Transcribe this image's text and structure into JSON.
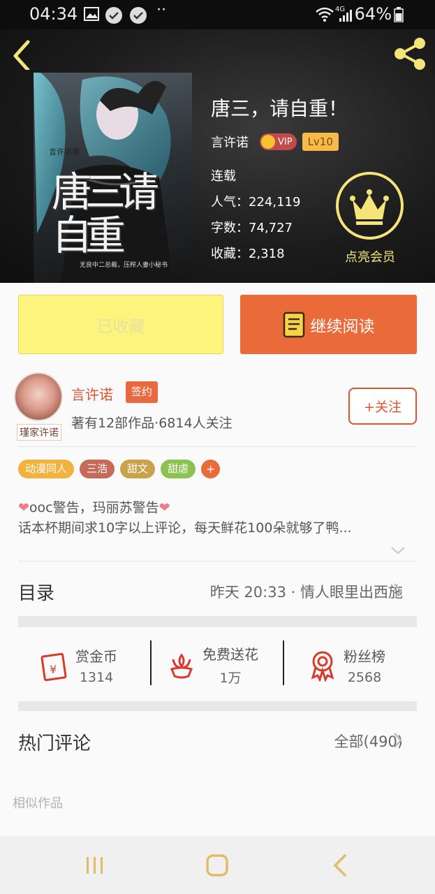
{
  "status_bar": {
    "time": "04:34",
    "dots": "··",
    "network": "4G",
    "battery": "64%"
  },
  "book": {
    "title": "唐三，请自重！",
    "author": "言许诺",
    "vip_label": "VIP",
    "level": "Lv10",
    "status": "连载",
    "popularity": "人气：224,119",
    "word_count": "字数：74,727",
    "favorites": "收藏：2,318",
    "cover": {
      "author_line": "言许诺著",
      "title_chars": "唐三请自重",
      "tagline": "无良中二总裁，压榨人妻小秘书"
    }
  },
  "member": {
    "label": "点亮会员",
    "accent": "#f4e47a"
  },
  "actions": {
    "collected_label": "已收藏",
    "read_label": "继续阅读"
  },
  "author_card": {
    "name": "言许诺",
    "signed_label": "签约",
    "stats": "著有12部作品·6814人关注",
    "follow_label": "+关注",
    "avatar_tag": "瑾家许诺"
  },
  "tags": [
    {
      "label": "动漫同人",
      "color": "#f3b23d"
    },
    {
      "label": "三浩",
      "color": "#c66b58"
    },
    {
      "label": "甜文",
      "color": "#c9a24a"
    },
    {
      "label": "甜虐",
      "color": "#8cc250"
    }
  ],
  "tag_more": "+",
  "description": {
    "line1_text": "ooc警告，玛丽苏警告",
    "line2": "话本杯期间求10字以上评论，每天鲜花100朵就够了鸭..."
  },
  "catalog": {
    "title": "目录",
    "latest": "昨天 20:33 · 情人眼里出西施"
  },
  "stats": [
    {
      "label": "赏金币",
      "value": "1314",
      "icon": "red-envelope-icon"
    },
    {
      "label": "免费送花",
      "value": "1万",
      "icon": "flower-icon"
    },
    {
      "label": "粉丝榜",
      "value": "2568",
      "icon": "medal-icon"
    }
  ],
  "comments": {
    "title": "热门评论",
    "all_label": "全部(490)"
  },
  "similar": {
    "title": "相似作品"
  },
  "colors": {
    "accent_orange": "#ea6a3a",
    "accent_red": "#e0532f",
    "collected_yellow": "#fcf47c"
  }
}
